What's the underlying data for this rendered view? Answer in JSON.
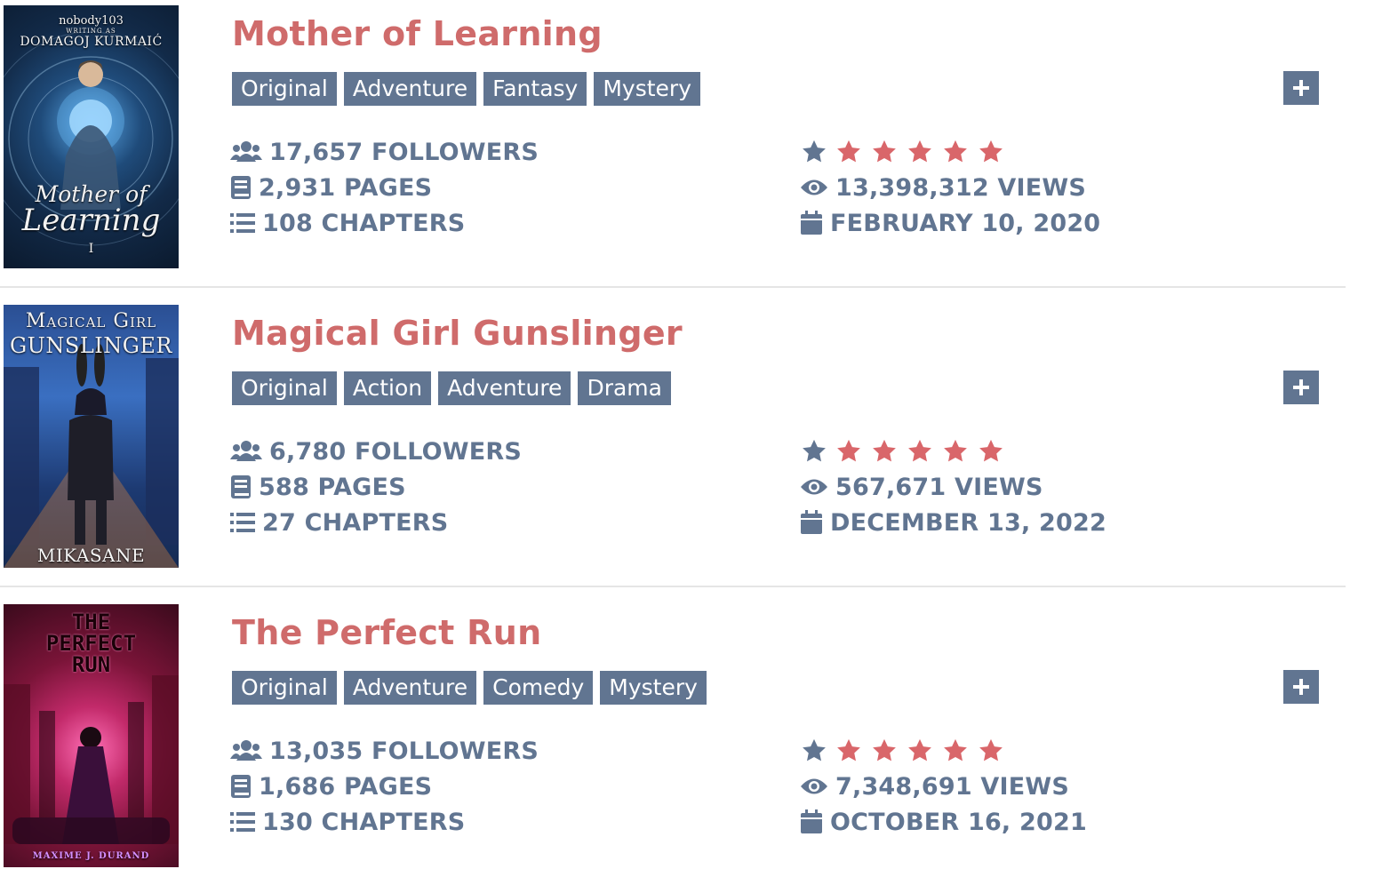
{
  "colors": {
    "title": "#cf6b6b",
    "tag_bg": "#617591",
    "stat_text": "#617591",
    "star_filled": "#d9666a",
    "divider": "#e5e5e5"
  },
  "fictions": [
    {
      "title": "Mother of Learning",
      "cover": {
        "top_text": "nobody103",
        "sub_text": "WRITING AS",
        "author": "DOMAGOJ KURMAIĆ",
        "title_line1": "Mother of",
        "title_line2": "Learning",
        "volume": "I"
      },
      "tags": [
        "Original",
        "Adventure",
        "Fantasy",
        "Mystery"
      ],
      "followers": "17,657 FOLLOWERS",
      "pages": "2,931 PAGES",
      "chapters": "108 CHAPTERS",
      "rating": 5,
      "views": "13,398,312 VIEWS",
      "date": "FEBRUARY 10, 2020"
    },
    {
      "title": "Magical Girl Gunslinger",
      "cover": {
        "title_line1": "Magical Girl",
        "title_line2": "GUNSLINGER",
        "author": "MIKASANE"
      },
      "tags": [
        "Original",
        "Action",
        "Adventure",
        "Drama"
      ],
      "followers": "6,780 FOLLOWERS",
      "pages": "588 PAGES",
      "chapters": "27 CHAPTERS",
      "rating": 5,
      "views": "567,671 VIEWS",
      "date": "DECEMBER 13, 2022"
    },
    {
      "title": "The Perfect Run",
      "cover": {
        "title_line1": "THE",
        "title_line2": "PERFECT",
        "title_line3": "RUN",
        "author": "MAXIME J. DURAND"
      },
      "tags": [
        "Original",
        "Adventure",
        "Comedy",
        "Mystery"
      ],
      "followers": "13,035 FOLLOWERS",
      "pages": "1,686 PAGES",
      "chapters": "130 CHAPTERS",
      "rating": 5,
      "views": "7,348,691 VIEWS",
      "date": "OCTOBER 16, 2021"
    }
  ],
  "icons": {
    "followers": "users-icon",
    "pages": "book-icon",
    "chapters": "list-icon",
    "rating": "star-icon",
    "views": "eye-icon",
    "date": "calendar-icon",
    "add": "plus-icon"
  }
}
